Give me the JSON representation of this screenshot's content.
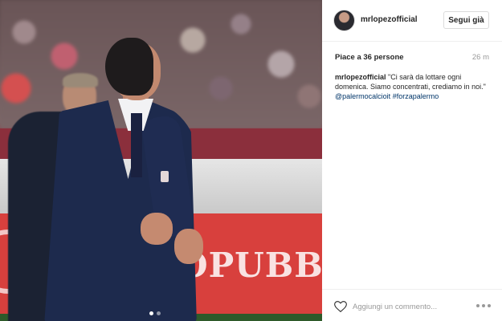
{
  "post": {
    "username": "mrlopezofficial",
    "follow_label": "Segui già",
    "likes_text": "Piace a 36 persone",
    "time_ago": "26 m",
    "caption": {
      "user": "mrlopezofficial",
      "text": "\"Ci sarà da lottare ogni domenica. Siamo concentrati, crediamo in noi.\"",
      "tags": [
        "@palermocalcioit",
        "#forzapalermo"
      ]
    },
    "comment_placeholder": "Aggiungi un commento...",
    "photo": {
      "ad_text": "OPUBBLI",
      "carousel_total": 2,
      "carousel_active": 0
    }
  },
  "colors": {
    "link": "#003569",
    "username": "#262626",
    "muted": "#999999",
    "border": "#efefef"
  },
  "icons": [
    "heart-icon",
    "more-options-icon"
  ]
}
